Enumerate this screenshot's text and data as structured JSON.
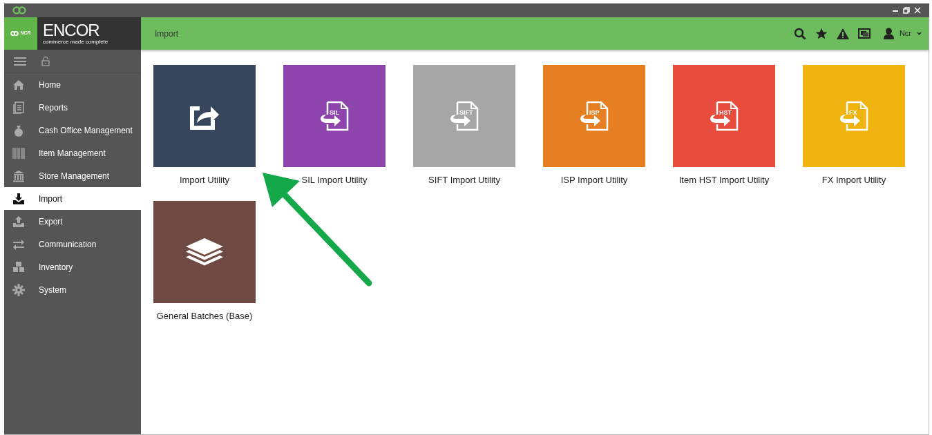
{
  "brand": {
    "badge": "NCR",
    "name": "ENCOR",
    "tagline": "commerce made complete"
  },
  "header": {
    "title": "Import",
    "user": "Ncr"
  },
  "sidebar": {
    "items": [
      {
        "label": "Home",
        "selected": false
      },
      {
        "label": "Reports",
        "selected": false
      },
      {
        "label": "Cash Office Management",
        "selected": false
      },
      {
        "label": "Item Management",
        "selected": false
      },
      {
        "label": "Store Management",
        "selected": false
      },
      {
        "label": "Import",
        "selected": true
      },
      {
        "label": "Export",
        "selected": false
      },
      {
        "label": "Communication",
        "selected": false
      },
      {
        "label": "Inventory",
        "selected": false
      },
      {
        "label": "System",
        "selected": false
      }
    ]
  },
  "tiles": [
    {
      "label": "Import Utility",
      "kind": "share",
      "color": "#36465d"
    },
    {
      "label": "SIL Import Utility",
      "kind": "file",
      "icon_text": "SIL",
      "color": "#8e44ad"
    },
    {
      "label": "SIFT Import Utility",
      "kind": "file",
      "icon_text": "SIFT",
      "color": "#a6a6a6"
    },
    {
      "label": "ISP Import Utility",
      "kind": "file",
      "icon_text": "ISP",
      "color": "#e67e22"
    },
    {
      "label": "Item HST Import Utility",
      "kind": "file",
      "icon_text": "HST",
      "color": "#e74c3c"
    },
    {
      "label": "FX Import Utility",
      "kind": "file",
      "icon_text": "FX",
      "color": "#f0b411"
    },
    {
      "label": "General Batches (Base)",
      "kind": "layers",
      "color": "#6f4a43"
    }
  ]
}
